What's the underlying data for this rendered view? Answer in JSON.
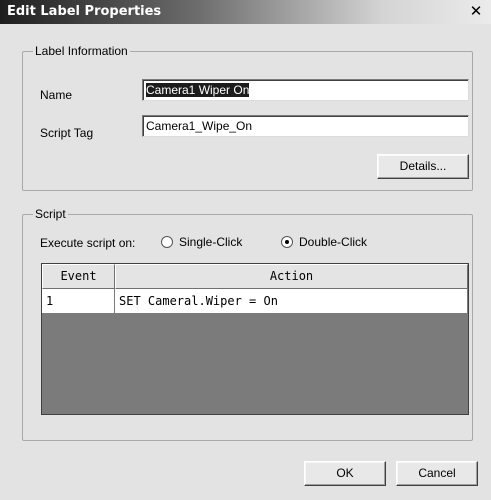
{
  "dialog": {
    "title": "Edit Label Properties",
    "close_glyph": "✕"
  },
  "label_info": {
    "legend": "Label Information",
    "name_label": "Name",
    "name_value": "Camera1 Wiper On",
    "tag_label": "Script Tag",
    "tag_value": "Camera1_Wipe_On",
    "details_label": "Details..."
  },
  "script": {
    "legend": "Script",
    "execute_label": "Execute script on:",
    "options": [
      {
        "label": "Single-Click",
        "checked": false
      },
      {
        "label": "Double-Click",
        "checked": true
      }
    ],
    "columns": [
      "Event",
      "Action"
    ],
    "rows": [
      {
        "event": "1",
        "action": "SET Cameral.Wiper = On"
      }
    ]
  },
  "footer": {
    "ok_label": "OK",
    "cancel_label": "Cancel"
  },
  "icons": {
    "close": "close-icon",
    "radio": "radio-icon"
  }
}
